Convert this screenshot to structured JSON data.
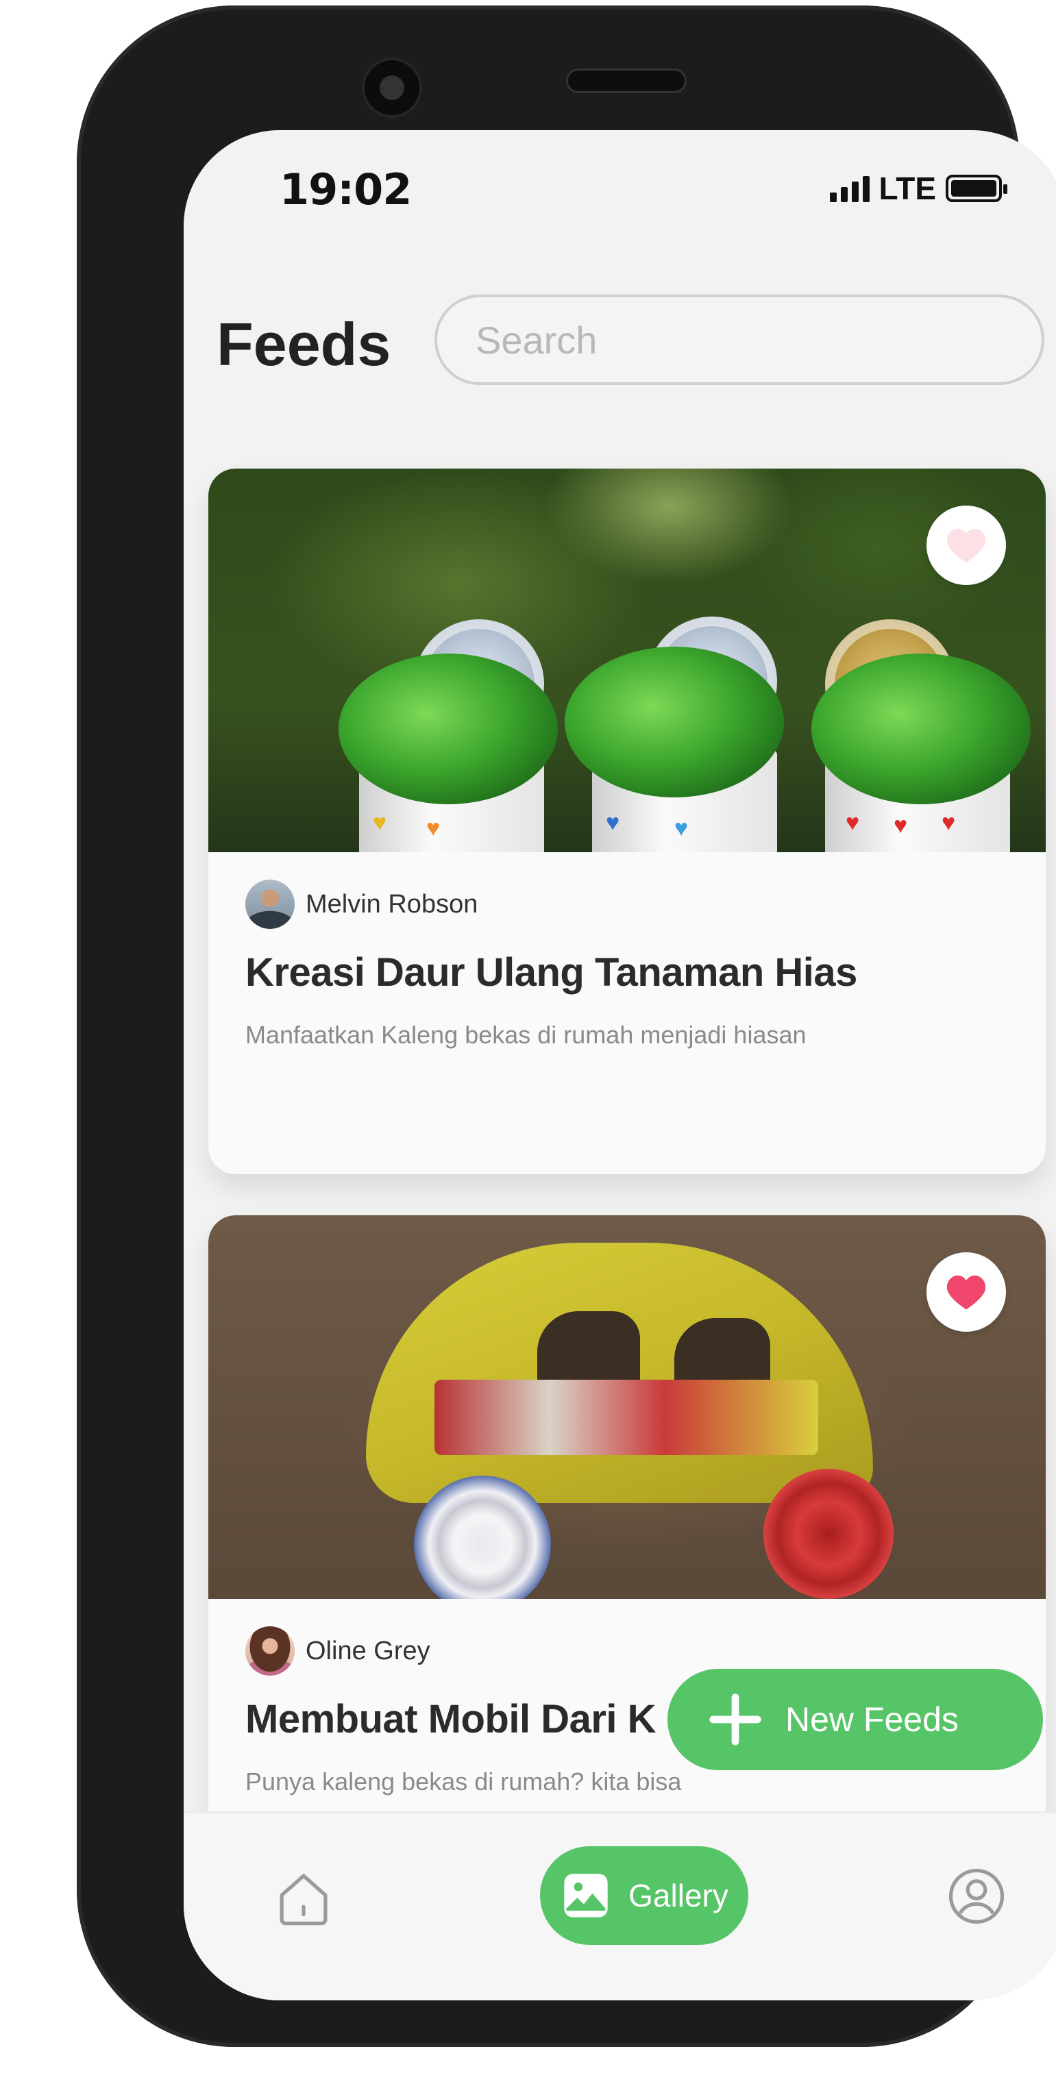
{
  "status_bar": {
    "time": "19:02",
    "network": "LTE"
  },
  "header": {
    "title": "Feeds",
    "search_placeholder": "Search"
  },
  "feeds": [
    {
      "author": "Melvin Robson",
      "title": "Kreasi Daur Ulang Tanaman Hias",
      "description": "Manfaatkan Kaleng bekas di rumah menjadi hiasan",
      "liked": false,
      "image": "plants-in-cans-photo"
    },
    {
      "author": "Oline Grey",
      "title": "Membuat Mobil Dari K",
      "description": "Punya kaleng bekas di rumah? kita bisa",
      "liked": true,
      "image": "toy-car-photo"
    }
  ],
  "fab": {
    "label": "New Feeds",
    "icon": "plus-icon"
  },
  "bottom_nav": {
    "gallery_label": "Gallery",
    "items": [
      "home-icon",
      "gallery-icon",
      "profile-icon"
    ]
  },
  "colors": {
    "accent_green": "#56c568",
    "like_pink": "#f0466b",
    "unlike_pink": "#fde0e6",
    "title_text": "#2b2b2b",
    "muted_text": "#8a8a8a"
  }
}
